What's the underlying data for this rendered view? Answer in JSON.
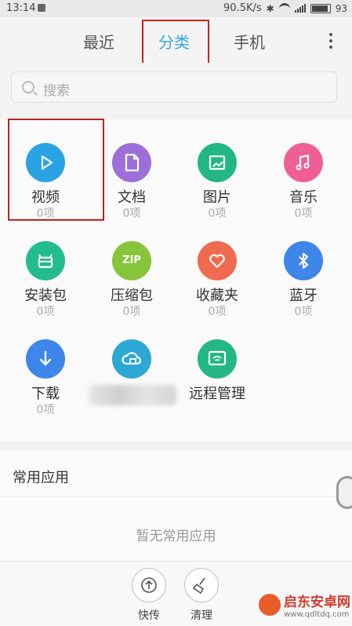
{
  "status_bar": {
    "time": "13:14",
    "network_speed": "90.5K/s",
    "battery": "93"
  },
  "tabs": [
    {
      "label": "最近"
    },
    {
      "label": "分类",
      "active": true
    },
    {
      "label": "手机"
    }
  ],
  "search": {
    "placeholder": "搜索"
  },
  "categories": [
    {
      "label": "视频",
      "count": "0项",
      "color": "#2aa3e4",
      "icon": "play-icon"
    },
    {
      "label": "文档",
      "count": "0项",
      "color": "#9c6fd9",
      "icon": "document-icon"
    },
    {
      "label": "图片",
      "count": "0项",
      "color": "#22b784",
      "icon": "image-icon"
    },
    {
      "label": "音乐",
      "count": "0项",
      "color": "#ef5f96",
      "icon": "music-icon"
    },
    {
      "label": "安装包",
      "count": "0项",
      "color": "#22bc8f",
      "icon": "package-icon"
    },
    {
      "label": "压缩包",
      "count": "0项",
      "color": "#86c43a",
      "icon": "zip-icon",
      "icon_text": "ZIP"
    },
    {
      "label": "收藏夹",
      "count": "0项",
      "color": "#f06a4f",
      "icon": "heart-icon"
    },
    {
      "label": "蓝牙",
      "count": "0项",
      "color": "#3f86ea",
      "icon": "bluetooth-icon"
    },
    {
      "label": "下载",
      "count": "0项",
      "color": "#3f86ea",
      "icon": "download-icon"
    },
    {
      "label": "",
      "count": "",
      "color": "#2da8d5",
      "icon": "cloud-icon"
    },
    {
      "label": "远程管理",
      "count": "",
      "color": "#22b784",
      "icon": "remote-icon"
    }
  ],
  "common_apps": {
    "title": "常用应用",
    "empty_text": "暂无常用应用"
  },
  "bottom_bar": {
    "transfer_label": "快传",
    "clean_label": "清理"
  },
  "watermark": {
    "name": "启东安卓网",
    "url": "www.qdltdq.com"
  }
}
